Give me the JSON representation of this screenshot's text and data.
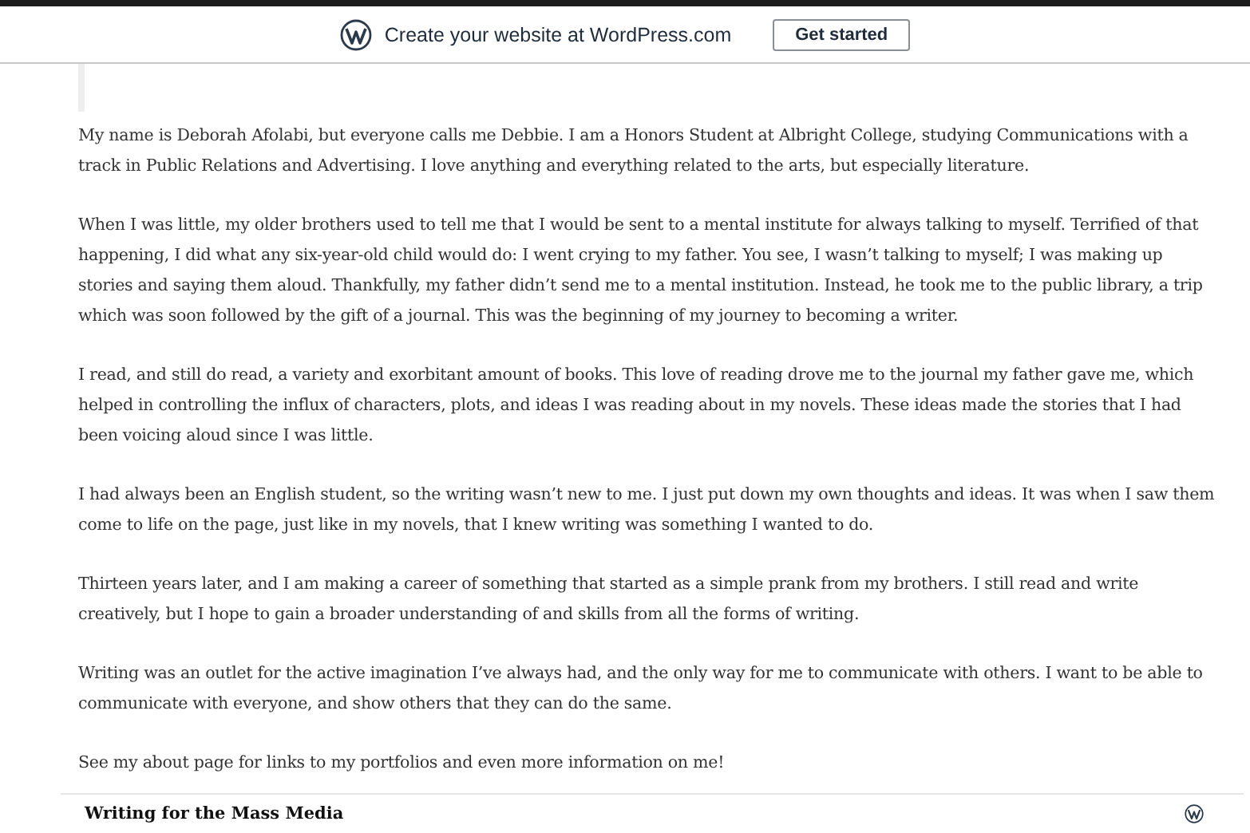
{
  "banner": {
    "text": "Create your website at WordPress.com",
    "button": "Get started"
  },
  "paragraphs": [
    "My name is Deborah Afolabi, but everyone calls me Debbie. I am a Honors Student at Albright College, studying Communications with a track in Public Relations and Advertising. I love anything and everything related to the arts, but especially literature.",
    "When I was little, my older brothers used to tell me that I would be sent to a mental institute for always talking to myself. Terrified of that happening, I did what any six-year-old child would do: I went crying to my father. You see, I wasn’t talking to myself; I was making up stories and saying them aloud. Thankfully, my father didn’t send me to a mental institution. Instead, he took me to the public library, a trip which was soon followed by the gift of a journal. This was the beginning of my journey to becoming a writer.",
    "I read, and still do read, a variety and exorbitant amount of books. This love of reading drove me to the journal my father gave me, which helped in controlling the influx of characters, plots, and ideas I was reading about in my novels. These ideas made the stories that I had been voicing aloud since I was little.",
    "I had always been an English student, so the writing wasn’t new to me. I just put down my own thoughts and ideas. It was when I saw them come to life on the page, just like in my novels, that I knew writing was something I wanted to do.",
    "Thirteen years later, and I am making a career of something that started as a simple prank from my brothers. I still read and write creatively, but I hope to gain a broader understanding of and skills from all the forms of writing.",
    "Writing was an outlet for the active imagination I’ve always had, and the only way for me to communicate with others. I want to be able to communicate with everyone, and show others that they can do the same.",
    "See my about page for links to my portfolios and even more information on me!"
  ],
  "footer": {
    "site_title": "Writing for the Mass Media"
  }
}
